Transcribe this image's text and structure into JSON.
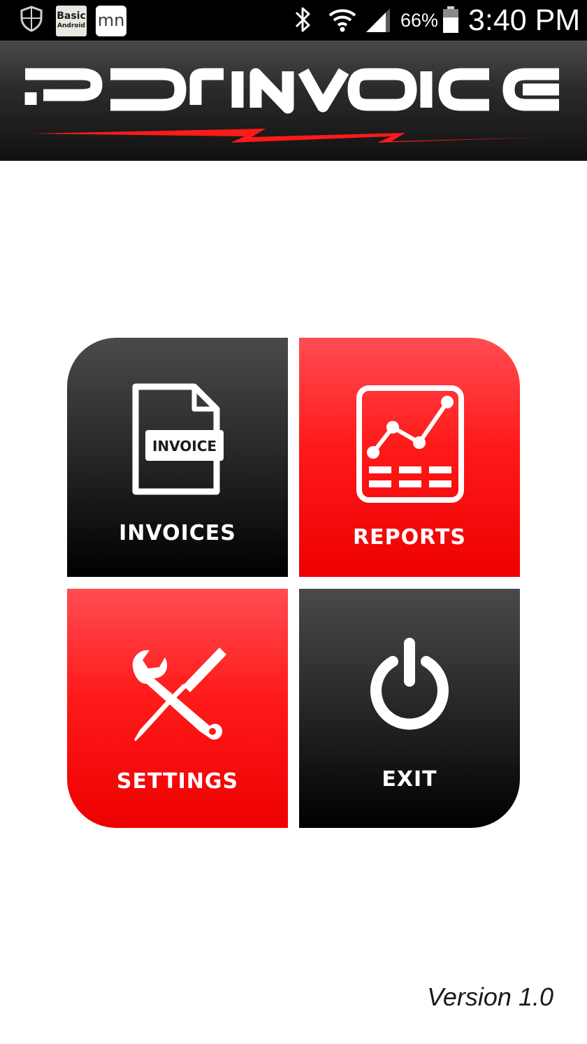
{
  "status_bar": {
    "notifications": [
      {
        "icon": "shield-icon"
      },
      {
        "icon": "basic-android-icon",
        "line1": "Basic",
        "line2": "Android"
      },
      {
        "icon": "mn-app-icon",
        "label": "mn"
      }
    ],
    "bluetooth_icon": "bluetooth-icon",
    "wifi_icon": "wifi-icon",
    "signal_icon": "signal-icon",
    "battery_percent": "66%",
    "battery_level": 0.66,
    "time": "3:40 PM"
  },
  "header": {
    "logo_text": "PDR INVOICE",
    "accent_color": "#ff1a1a"
  },
  "menu": {
    "tiles": [
      {
        "label": "INVOICES",
        "icon": "invoice-document-icon",
        "badge_text": "INVOICE",
        "color": "#2a2a2a"
      },
      {
        "label": "REPORTS",
        "icon": "chart-report-icon",
        "color": "#ff1a1a"
      },
      {
        "label": "SETTINGS",
        "icon": "wrench-screwdriver-icon",
        "color": "#ff1a1a"
      },
      {
        "label": "EXIT",
        "icon": "power-icon",
        "color": "#2a2a2a"
      }
    ]
  },
  "footer": {
    "version": "Version 1.0"
  }
}
